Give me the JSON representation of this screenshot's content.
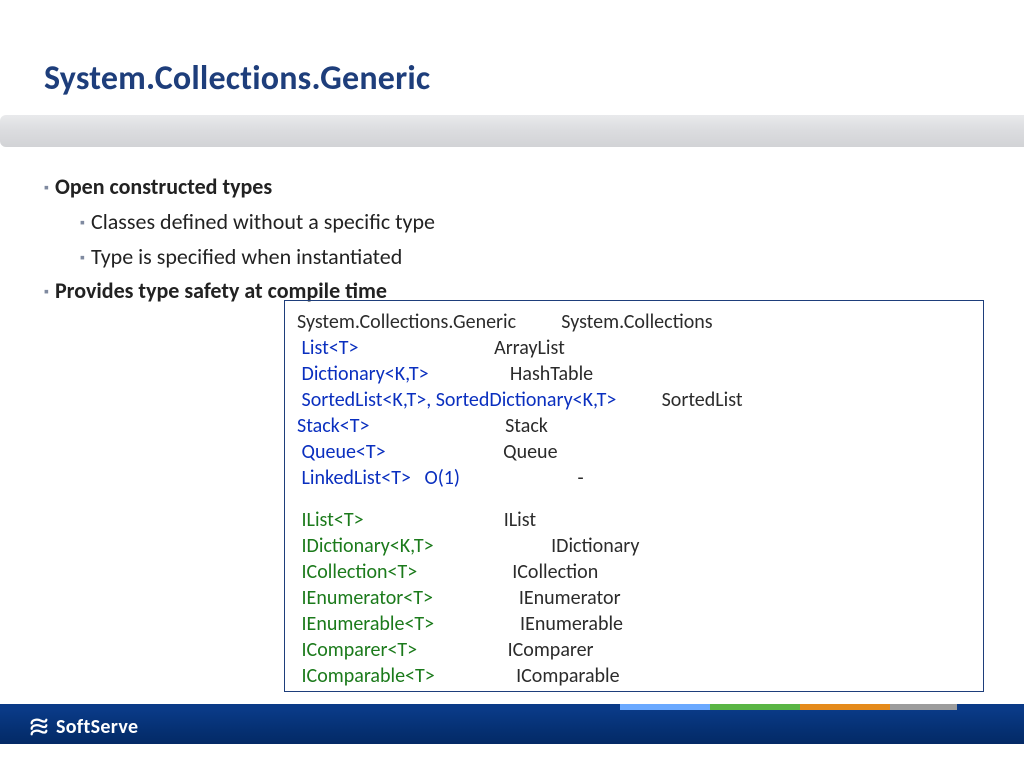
{
  "title": "System.Collections.Generic",
  "bullets": {
    "b1": "Open constructed types",
    "b1a": "Classes defined without a specific type",
    "b1b": "Type is specified when instantiated",
    "b2": "Provides type safety at compile time"
  },
  "codebox": {
    "header_left": "System.Collections.Generic",
    "header_right": "System.Collections",
    "rows_blue": [
      {
        "left": " List<T>",
        "right": "ArrayList"
      },
      {
        "left": " Dictionary<K,T>",
        "right": "HashTable"
      },
      {
        "left": " SortedList<K,T>, SortedDictionary<K,T>",
        "right": "SortedList"
      },
      {
        "left": "Stack<T>",
        "right": "Stack"
      },
      {
        "left": " Queue<T>",
        "right": "Queue"
      },
      {
        "left": " LinkedList<T>   O(1)",
        "right": "     -"
      }
    ],
    "rows_green": [
      {
        "left": " IList<T>",
        "right": "IList"
      },
      {
        "left": " IDictionary<K,T>",
        "right": "        IDictionary"
      },
      {
        "left": " ICollection<T>",
        "right": "ICollection"
      },
      {
        "left": " IEnumerator<T>",
        "right": "     IEnumerator"
      },
      {
        "left": " IEnumerable<T>",
        "right": "     IEnumerable"
      },
      {
        "left": " IComparer<T>",
        "right": "IComparer"
      },
      {
        "left": " IComparable<T>",
        "right": "     IComparable"
      }
    ]
  },
  "footer": {
    "brand": "SoftServe",
    "stripe_colors": [
      "#0a3a87",
      "#6aa9ff",
      "#59b544",
      "#e58a1a",
      "#9c9c9c",
      "#0a3a87"
    ],
    "stripe_widths": [
      620,
      90,
      90,
      90,
      67,
      67
    ]
  }
}
